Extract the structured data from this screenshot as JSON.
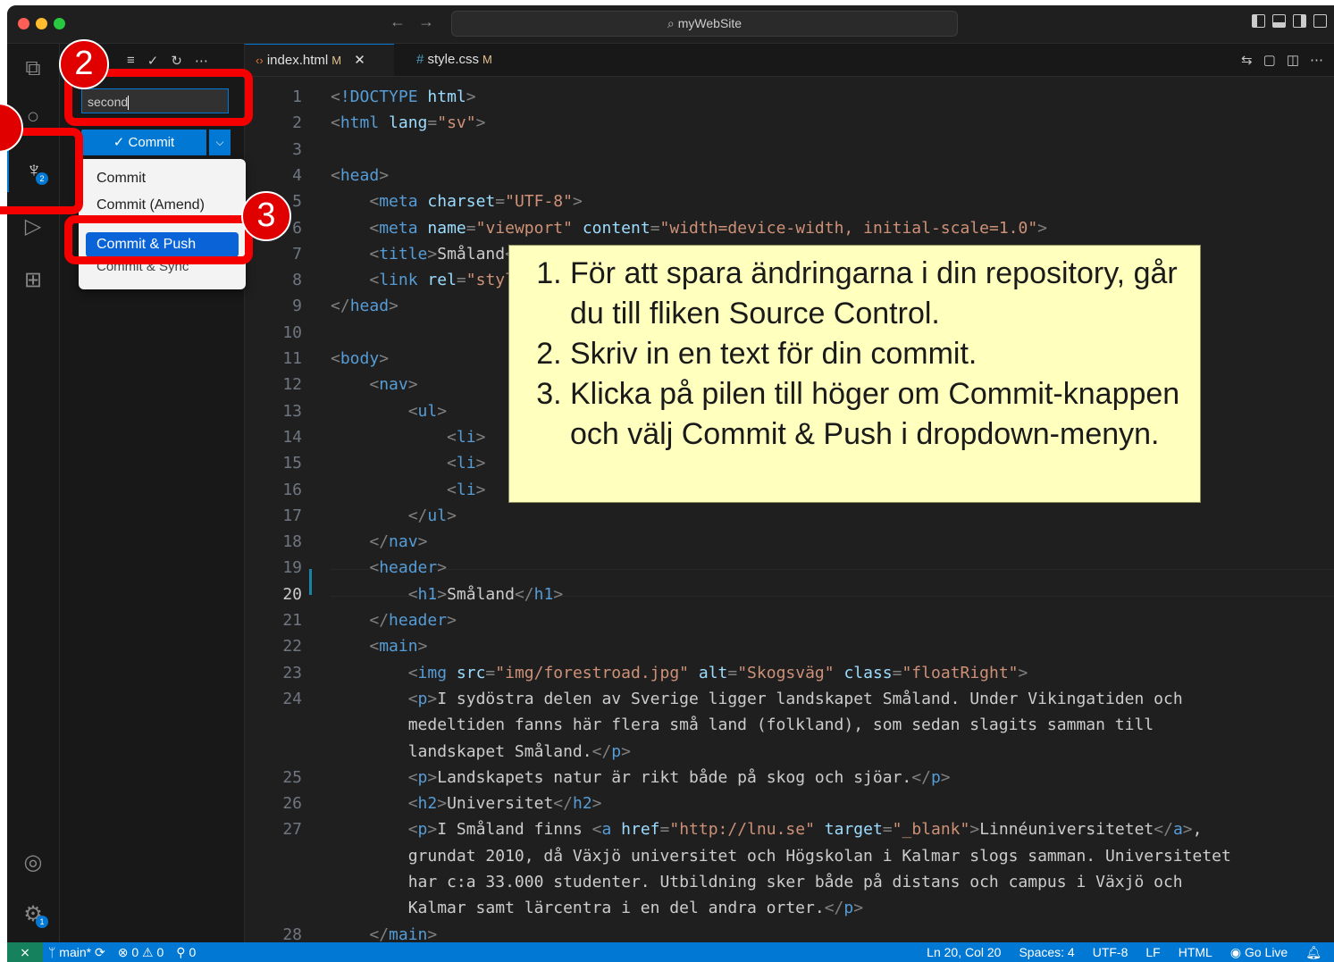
{
  "window": {
    "title": "myWebSite"
  },
  "colors": {
    "accent": "#0078d4",
    "highlight_red": "#f50000",
    "callout_bg": "#ffffbe"
  },
  "activity_bar": {
    "items": [
      {
        "name": "explorer-icon"
      },
      {
        "name": "search-icon"
      },
      {
        "name": "source-control-icon",
        "badge": "2",
        "active": true
      },
      {
        "name": "run-debug-icon"
      },
      {
        "name": "extensions-icon"
      }
    ],
    "bottom": [
      {
        "name": "account-icon"
      },
      {
        "name": "settings-gear-icon",
        "badge": "1"
      }
    ]
  },
  "source_control": {
    "toolbar_icons": [
      "list-icon",
      "check-icon",
      "refresh-icon",
      "more-icon"
    ],
    "message_value": "second",
    "commit_label": "✓ Commit",
    "dropdown_menu": [
      "Commit",
      "Commit (Amend)",
      "Commit & Push",
      "Commit & Sync"
    ],
    "selected_item": "Commit & Push"
  },
  "tabs": [
    {
      "label": "index.html",
      "modified": "M",
      "icon": "code-file-icon",
      "active": true
    },
    {
      "label": "style.css",
      "modified": "M",
      "icon": "hash-icon",
      "active": false
    }
  ],
  "editor": {
    "current_line": "20",
    "lines": [
      {
        "n": "1",
        "text": "<!DOCTYPE html>"
      },
      {
        "n": "2",
        "text": "<html lang=\"sv\">"
      },
      {
        "n": "3",
        "text": ""
      },
      {
        "n": "4",
        "text": "<head>"
      },
      {
        "n": "5",
        "text": "    <meta charset=\"UTF-8\">"
      },
      {
        "n": "6",
        "text": "    <meta name=\"viewport\" content=\"width=device-width, initial-scale=1.0\">"
      },
      {
        "n": "7",
        "text": "    <title>Småland</title>"
      },
      {
        "n": "8",
        "text": "    <link rel=\"stylesheet\" href=\"css/style.css\">"
      },
      {
        "n": "9",
        "text": "</head>"
      },
      {
        "n": "10",
        "text": ""
      },
      {
        "n": "11",
        "text": "<body>"
      },
      {
        "n": "12",
        "text": "    <nav>"
      },
      {
        "n": "13",
        "text": "        <ul>"
      },
      {
        "n": "14",
        "text": "            <li>"
      },
      {
        "n": "15",
        "text": "            <li>"
      },
      {
        "n": "16",
        "text": "            <li>"
      },
      {
        "n": "17",
        "text": "        </ul>"
      },
      {
        "n": "18",
        "text": "    </nav>"
      },
      {
        "n": "19",
        "text": "    <header>"
      },
      {
        "n": "20",
        "text": "        <h1>Småland</h1>"
      },
      {
        "n": "21",
        "text": "    </header>"
      },
      {
        "n": "22",
        "text": "    <main>"
      },
      {
        "n": "23",
        "text": "        <img src=\"img/forestroad.jpg\" alt=\"Skogsväg\" class=\"floatRight\">"
      },
      {
        "n": "24",
        "text": "        <p>I sydöstra delen av Sverige ligger landskapet Småland. Under Vikingatiden och"
      },
      {
        "n": "",
        "text": "        medeltiden fanns här flera små land (folkland), som sedan slagits samman till"
      },
      {
        "n": "",
        "text": "        landskapet Småland.</p>"
      },
      {
        "n": "25",
        "text": "        <p>Landskapets natur är rikt både på skog och sjöar.</p>"
      },
      {
        "n": "26",
        "text": "        <h2>Universitet</h2>"
      },
      {
        "n": "27",
        "text": "        <p>I Småland finns <a href=\"http://lnu.se\" target=\"_blank\">Linnéuniversitetet</a>,"
      },
      {
        "n": "",
        "text": "        grundat 2010, då Växjö universitet och Högskolan i Kalmar slogs samman. Universitetet"
      },
      {
        "n": "",
        "text": "        har c:a 33.000 studenter. Utbildning sker både på distans och campus i Växjö och"
      },
      {
        "n": "",
        "text": "        Kalmar samt lärcentra i en del andra orter.</p>"
      },
      {
        "n": "28",
        "text": "    </main>"
      }
    ]
  },
  "callout": {
    "steps": [
      "För att spara ändringarna i din repository, går du till fliken Source Control.",
      "Skriv in en text för din commit.",
      "Klicka på pilen till höger om Commit-knappen och välj Commit & Push i dropdown-menyn."
    ]
  },
  "annotations": {
    "step2": "2",
    "step3": "3"
  },
  "status_bar": {
    "branch": "main*",
    "errors": "0",
    "warnings": "0",
    "ports": "0",
    "position": "Ln 20, Col 20",
    "spaces": "Spaces: 4",
    "encoding": "UTF-8",
    "eol": "LF",
    "language": "HTML",
    "go_live": "Go Live"
  }
}
